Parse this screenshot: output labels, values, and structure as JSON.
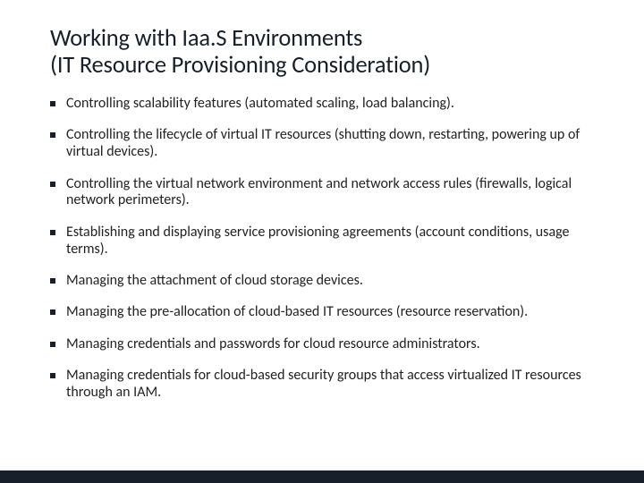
{
  "title_line1": "Working with Iaa.S Environments",
  "title_line2": "(IT Resource Provisioning Consideration)",
  "bullets": [
    "Controlling scalability features (automated scaling, load balancing).",
    "Controlling the lifecycle of virtual IT resources (shutting down, restarting, powering up of virtual devices).",
    "Controlling the virtual network environment and network access rules (firewalls, logical network perimeters).",
    "Establishing and displaying service provisioning agreements (account conditions, usage terms).",
    "Managing the attachment of cloud storage devices.",
    "Managing the pre-allocation of cloud-based IT resources (resource reservation).",
    "Managing credentials and passwords for cloud resource administrators.",
    "Managing credentials for cloud-based security groups that access virtualized IT resources through an IAM."
  ]
}
